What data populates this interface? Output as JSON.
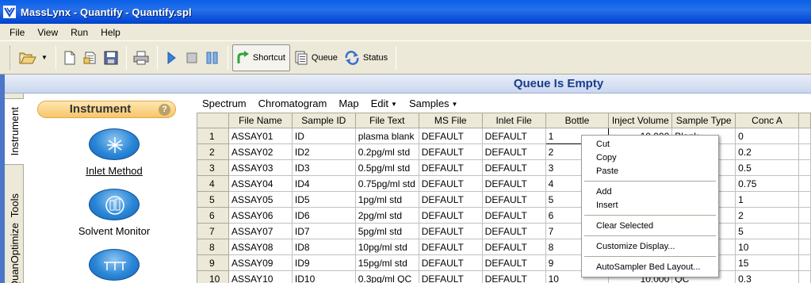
{
  "window": {
    "title": "MassLynx - Quantify - Quantify.spl"
  },
  "menubar": [
    "File",
    "View",
    "Run",
    "Help"
  ],
  "toolbar": {
    "shortcut": "Shortcut",
    "queue": "Queue",
    "status": "Status"
  },
  "queue_status": "Queue Is Empty",
  "vtabs": [
    "Instrument",
    "Tools",
    "QuanOptimize"
  ],
  "instrument": {
    "title": "Instrument",
    "help": "?",
    "items": [
      "Inlet Method",
      "Solvent Monitor"
    ]
  },
  "submenu": [
    "Spectrum",
    "Chromatogram",
    "Map",
    "Edit",
    "Samples"
  ],
  "grid": {
    "columns": [
      "",
      "File Name",
      "Sample ID",
      "File Text",
      "MS File",
      "Inlet File",
      "Bottle",
      "Inject Volume",
      "Sample Type",
      "Conc A"
    ],
    "rows": [
      [
        "1",
        "ASSAY01",
        "ID",
        "plasma blank",
        "DEFAULT",
        "DEFAULT",
        "1",
        "10.000",
        "Blank",
        "0"
      ],
      [
        "2",
        "ASSAY02",
        "ID2",
        "0.2pg/ml std",
        "DEFAULT",
        "DEFAULT",
        "2",
        "",
        "",
        "0.2"
      ],
      [
        "3",
        "ASSAY03",
        "ID3",
        "0.5pg/ml std",
        "DEFAULT",
        "DEFAULT",
        "3",
        "",
        "",
        "0.5"
      ],
      [
        "4",
        "ASSAY04",
        "ID4",
        "0.75pg/ml std",
        "DEFAULT",
        "DEFAULT",
        "4",
        "",
        "",
        "0.75"
      ],
      [
        "5",
        "ASSAY05",
        "ID5",
        "1pg/ml std",
        "DEFAULT",
        "DEFAULT",
        "5",
        "",
        "",
        "1"
      ],
      [
        "6",
        "ASSAY06",
        "ID6",
        "2pg/ml std",
        "DEFAULT",
        "DEFAULT",
        "6",
        "",
        "",
        "2"
      ],
      [
        "7",
        "ASSAY07",
        "ID7",
        "5pg/ml std",
        "DEFAULT",
        "DEFAULT",
        "7",
        "",
        "",
        "5"
      ],
      [
        "8",
        "ASSAY08",
        "ID8",
        "10pg/ml std",
        "DEFAULT",
        "DEFAULT",
        "8",
        "",
        "",
        "10"
      ],
      [
        "9",
        "ASSAY09",
        "ID9",
        "15pg/ml std",
        "DEFAULT",
        "DEFAULT",
        "9",
        "",
        "",
        "15"
      ],
      [
        "10",
        "ASSAY10",
        "ID10",
        "0.3pg/ml QC",
        "DEFAULT",
        "DEFAULT",
        "10",
        "10.000",
        "QC",
        "0.3"
      ]
    ]
  },
  "context_menu": {
    "items": [
      "Cut",
      "Copy",
      "Paste",
      "Add",
      "Insert",
      "Clear Selected",
      "Customize Display...",
      "AutoSampler Bed Layout..."
    ]
  }
}
